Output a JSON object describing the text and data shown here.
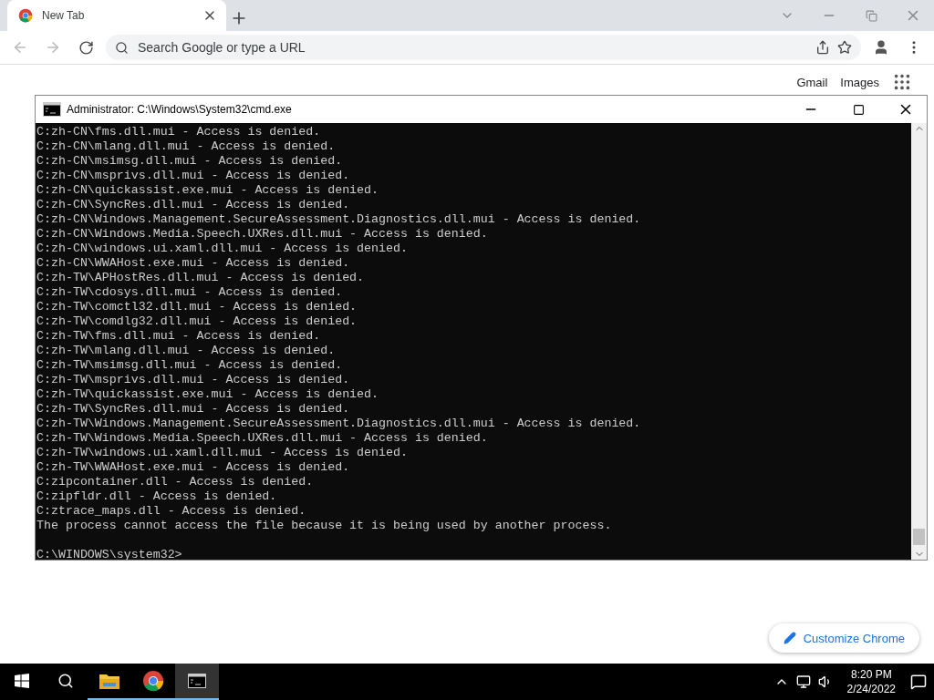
{
  "browser": {
    "tab": {
      "title": "New Tab"
    },
    "address": {
      "placeholder": "Search Google or type a URL"
    },
    "top_links": [
      "Gmail",
      "Images"
    ],
    "customize_button": "Customize Chrome"
  },
  "console": {
    "title": "Administrator: C:\\Windows\\System32\\cmd.exe",
    "lines": [
      "C:zh-CN\\fms.dll.mui - Access is denied.",
      "C:zh-CN\\mlang.dll.mui - Access is denied.",
      "C:zh-CN\\msimsg.dll.mui - Access is denied.",
      "C:zh-CN\\msprivs.dll.mui - Access is denied.",
      "C:zh-CN\\quickassist.exe.mui - Access is denied.",
      "C:zh-CN\\SyncRes.dll.mui - Access is denied.",
      "C:zh-CN\\Windows.Management.SecureAssessment.Diagnostics.dll.mui - Access is denied.",
      "C:zh-CN\\Windows.Media.Speech.UXRes.dll.mui - Access is denied.",
      "C:zh-CN\\windows.ui.xaml.dll.mui - Access is denied.",
      "C:zh-CN\\WWAHost.exe.mui - Access is denied.",
      "C:zh-TW\\APHostRes.dll.mui - Access is denied.",
      "C:zh-TW\\cdosys.dll.mui - Access is denied.",
      "C:zh-TW\\comctl32.dll.mui - Access is denied.",
      "C:zh-TW\\comdlg32.dll.mui - Access is denied.",
      "C:zh-TW\\fms.dll.mui - Access is denied.",
      "C:zh-TW\\mlang.dll.mui - Access is denied.",
      "C:zh-TW\\msimsg.dll.mui - Access is denied.",
      "C:zh-TW\\msprivs.dll.mui - Access is denied.",
      "C:zh-TW\\quickassist.exe.mui - Access is denied.",
      "C:zh-TW\\SyncRes.dll.mui - Access is denied.",
      "C:zh-TW\\Windows.Management.SecureAssessment.Diagnostics.dll.mui - Access is denied.",
      "C:zh-TW\\Windows.Media.Speech.UXRes.dll.mui - Access is denied.",
      "C:zh-TW\\windows.ui.xaml.dll.mui - Access is denied.",
      "C:zh-TW\\WWAHost.exe.mui - Access is denied.",
      "C:zipcontainer.dll - Access is denied.",
      "C:zipfldr.dll - Access is denied.",
      "C:ztrace_maps.dll - Access is denied.",
      "The process cannot access the file because it is being used by another process."
    ],
    "prompt": "C:\\WINDOWS\\system32>"
  },
  "taskbar": {
    "apps": [
      {
        "kind": "explorer",
        "running": true,
        "selected": false
      },
      {
        "kind": "chrome",
        "running": true,
        "selected": false
      },
      {
        "kind": "console",
        "running": true,
        "selected": true
      }
    ],
    "time": "8:20 PM",
    "date": "2/24/2022"
  }
}
